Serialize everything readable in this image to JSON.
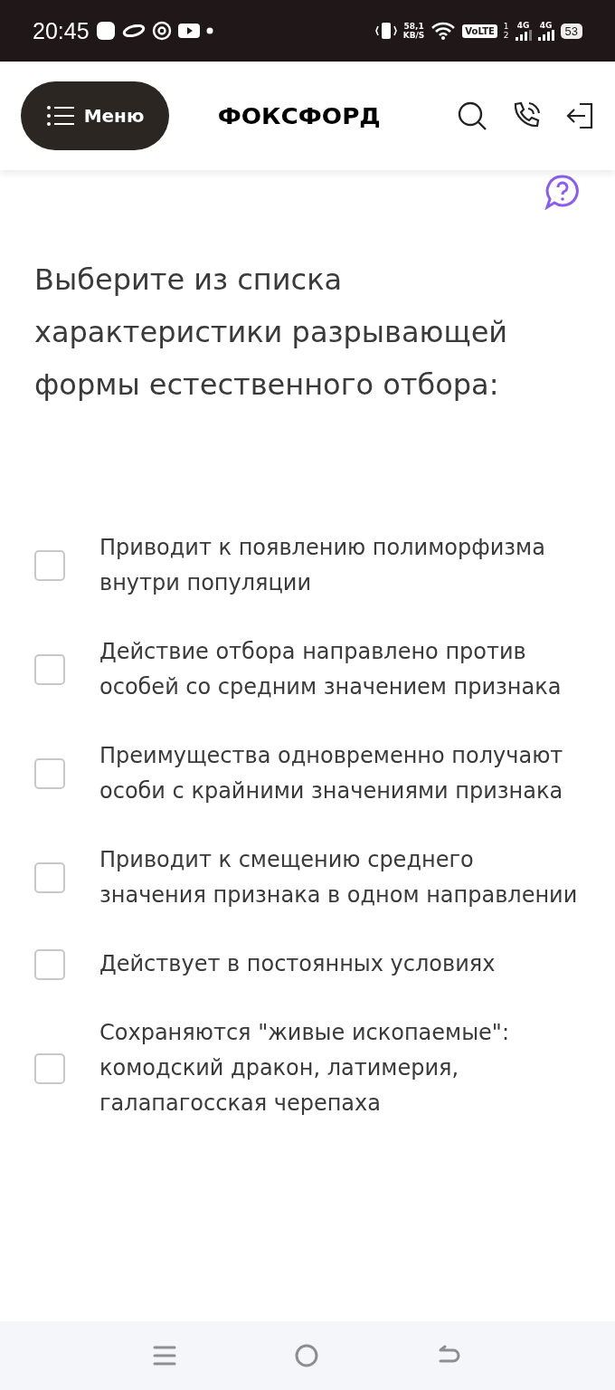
{
  "status_bar": {
    "time": "20:45",
    "speed_value": "58,1",
    "speed_unit": "KB/S",
    "volte": "VoLTE",
    "sim_1": "1",
    "sim_2": "2",
    "network_1": "4G",
    "network_2": "4G",
    "battery": "53"
  },
  "header": {
    "menu_label": "Меню",
    "logo": "ФОКСФОРД"
  },
  "question": "Выберите из списка характеристики разрывающей формы естественного отбора:",
  "options": [
    {
      "text": "Приводит к появлению полиморфизма внутри популяции",
      "checked": false
    },
    {
      "text": "Действие отбора направлено против особей со средним значением признака",
      "checked": false
    },
    {
      "text": "Преимущества одновременно получают особи с крайними значениями признака",
      "checked": false
    },
    {
      "text": "Приводит к смещению среднего значения признака в одном направлении",
      "checked": false
    },
    {
      "text": "Действует в постоянных условиях",
      "checked": false
    },
    {
      "text": "Сохраняются \"живые ископаемые\": комодский дракон, латимерия, галапагосская черепаха",
      "checked": false
    }
  ]
}
